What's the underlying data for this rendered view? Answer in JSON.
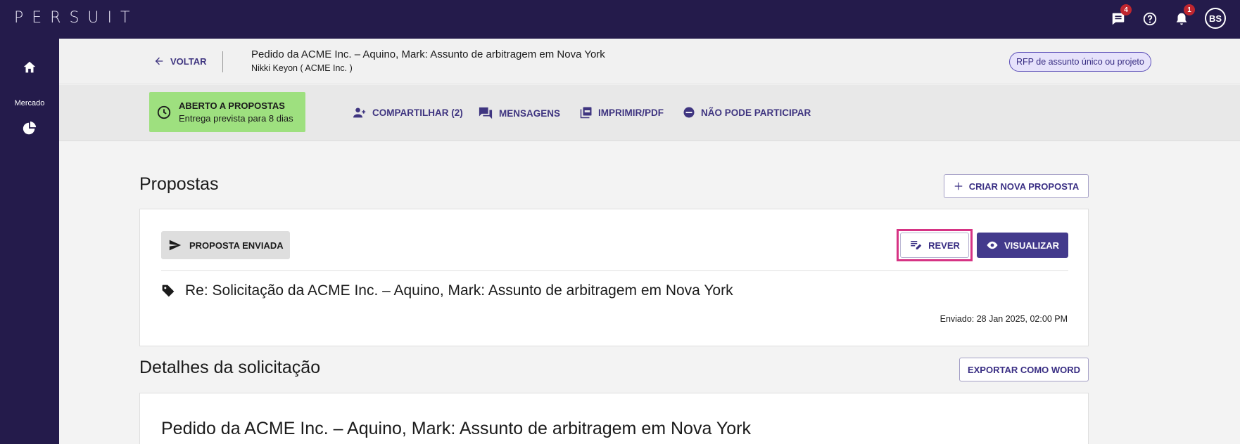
{
  "topbar": {
    "logo": "PERSUIT",
    "messages_badge": "4",
    "notifications_badge": "1",
    "avatar_initials": "BS",
    "icons": [
      "chat-icon",
      "help-icon",
      "bell-icon"
    ]
  },
  "sidebar": {
    "items": [
      {
        "icon": "home-icon",
        "label": ""
      },
      {
        "icon": "",
        "label": "Mercado"
      },
      {
        "icon": "pie-chart-icon",
        "label": ""
      }
    ]
  },
  "header": {
    "back_label": "VOLTAR",
    "request_title": "Pedido da ACME Inc. – Aquino, Mark: Assunto de arbitragem em Nova York",
    "request_subtitle": "Nikki Keyon ( ACME Inc. )",
    "rfp_type": "RFP de assunto único ou projeto"
  },
  "status": {
    "title": "ABERTO A PROPOSTAS",
    "subtitle": "Entrega prevista para 8 dias",
    "color": "#9ee07f"
  },
  "actions": {
    "share": "COMPARTILHAR (2)",
    "messages": "MENSAGENS",
    "print": "IMPRIMIR/PDF",
    "decline": "NÃO PODE PARTICIPAR"
  },
  "proposals": {
    "heading": "Propostas",
    "create_label": "CRIAR NOVA PROPOSTA",
    "sent_badge": "PROPOSTA ENVIADA",
    "review_label": "REVER",
    "view_label": "VISUALIZAR",
    "proposal_title": "Re: Solicitação da ACME Inc. – Aquino, Mark: Assunto de arbitragem em Nova York",
    "sent_date": "Enviado: 28 Jan 2025, 02:00 PM"
  },
  "details": {
    "heading": "Detalhes da solicitação",
    "export_label": "EXPORTAR COMO WORD",
    "title": "Pedido da ACME Inc. – Aquino, Mark: Assunto de arbitragem em Nova York"
  },
  "colors": {
    "nav_bg": "#241b4b",
    "accent": "#433a8c",
    "highlight": "#d63384",
    "badge": "#c0262f"
  }
}
